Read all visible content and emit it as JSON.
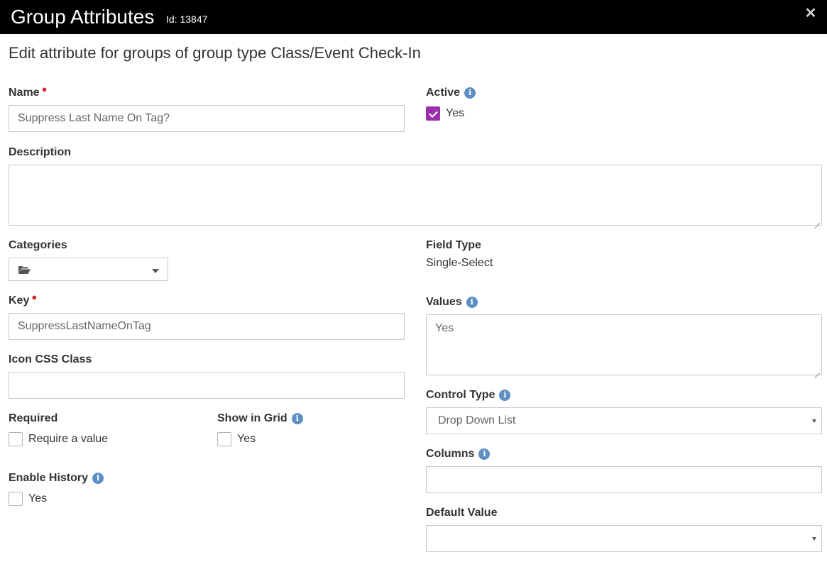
{
  "header": {
    "title": "Group Attributes",
    "id_label": "Id: 13847",
    "close_icon": "close-icon"
  },
  "subtitle": "Edit attribute for groups of group type Class/Event Check-In",
  "form": {
    "name": {
      "label": "Name",
      "required": true,
      "value": "Suppress Last Name On Tag?"
    },
    "active": {
      "label": "Active",
      "checked": true,
      "option_label": "Yes"
    },
    "description": {
      "label": "Description",
      "value": ""
    },
    "categories": {
      "label": "Categories",
      "icon": "folder-open-icon"
    },
    "field_type": {
      "label": "Field Type",
      "value": "Single-Select"
    },
    "key": {
      "label": "Key",
      "required": true,
      "value": "SuppressLastNameOnTag"
    },
    "values": {
      "label": "Values",
      "value": "Yes"
    },
    "icon_css_class": {
      "label": "Icon CSS Class",
      "value": ""
    },
    "control_type": {
      "label": "Control Type",
      "selected": "Drop Down List"
    },
    "required": {
      "label": "Required",
      "checked": false,
      "option_label": "Require a value"
    },
    "show_in_grid": {
      "label": "Show in Grid",
      "checked": false,
      "option_label": "Yes"
    },
    "columns": {
      "label": "Columns",
      "value": ""
    },
    "enable_history": {
      "label": "Enable History",
      "checked": false,
      "option_label": "Yes"
    },
    "default_value": {
      "label": "Default Value",
      "selected": ""
    }
  },
  "colors": {
    "header_bg": "#000000",
    "accent_checkbox": "#9b2fae",
    "required_marker": "#d62525",
    "info_icon": "#5d8fc4"
  }
}
